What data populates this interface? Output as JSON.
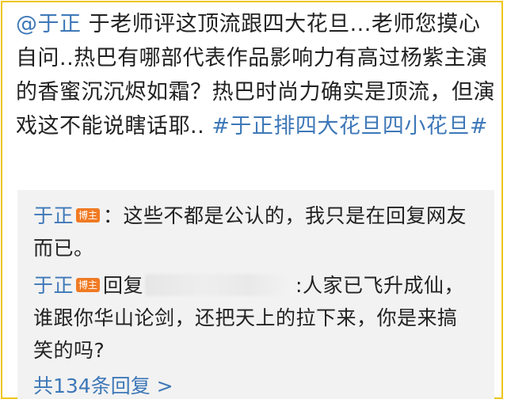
{
  "post": {
    "mention": "@于正",
    "text": " 于老师评这顶流跟四大花旦...老师您摸心自问..热巴有哪部代表作品影响力有高过杨紫主演的香蜜沉沉烬如霜？热巴时尚力确实是顶流，但演戏这不能说瞎话耶.. ",
    "hashtag": "#于正排四大花旦四小花旦#"
  },
  "replies": [
    {
      "author": "于正",
      "badge": "博主",
      "text": "：这些不都是公认的，我只是在回复网友而已。"
    },
    {
      "author": "于正",
      "badge": "博主",
      "reply_prefix": "回复",
      "text": ":人家已飞升成仙，谁跟你华山论剑，还把天上的拉下来，你是来搞笑的吗?"
    }
  ],
  "reply_count_link": "共134条回复 >",
  "colors": {
    "link": "#3e78b8",
    "border": "#f0c419",
    "badge": "#f07a23",
    "reply_bg": "#f2f2f2"
  }
}
